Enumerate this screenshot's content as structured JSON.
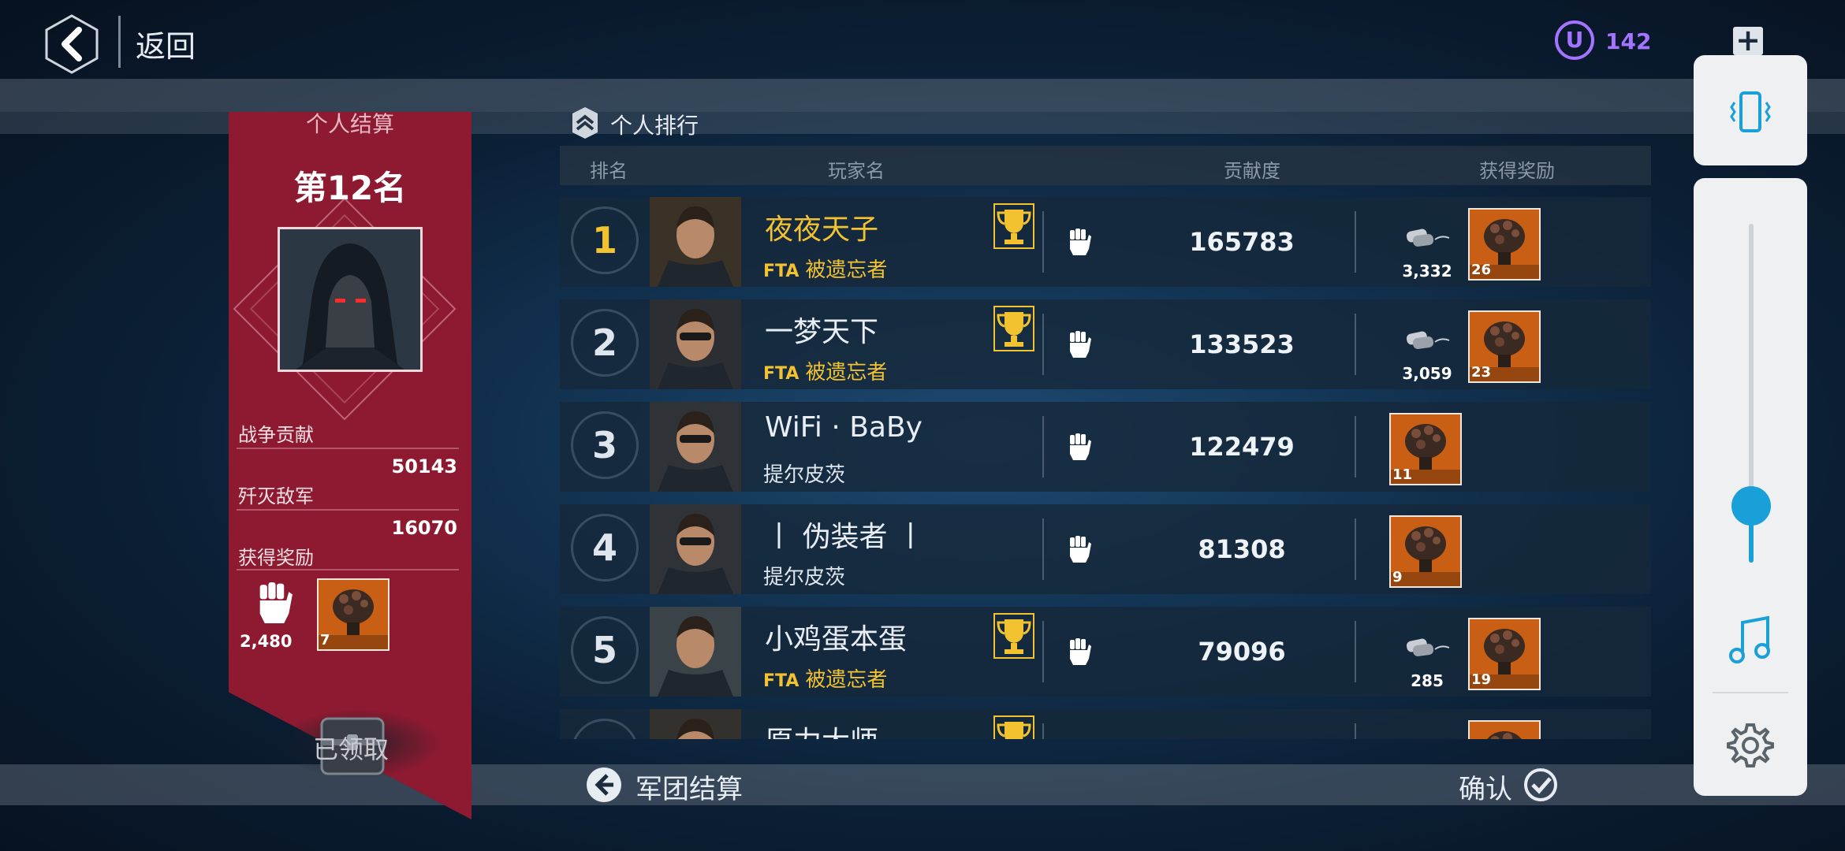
{
  "topbar": {
    "back_label": "返回",
    "currency_icon": "U",
    "currency_value": "142",
    "plus_label": "+"
  },
  "personal": {
    "title": "个人结算",
    "rank_text": "第12名",
    "stats": [
      {
        "label": "战争贡献",
        "value": "50143"
      },
      {
        "label": "歼灭敌军",
        "value": "16070"
      }
    ],
    "rewards_label": "获得奖励",
    "fist_count": "2,480",
    "reward_count": "7",
    "claimed_label": "已领取"
  },
  "ranking": {
    "title": "个人排行",
    "columns": [
      "排名",
      "玩家名",
      "贡献度",
      "获得奖励"
    ],
    "rows": [
      {
        "rank": "1",
        "name": "夜夜天子",
        "tag": "FTA",
        "guild": "被遗忘者",
        "contribution": "165783",
        "dogtag_count": "3,332",
        "reward_count": "26",
        "trophy": true
      },
      {
        "rank": "2",
        "name": "一梦天下",
        "tag": "FTA",
        "guild": "被遗忘者",
        "contribution": "133523",
        "dogtag_count": "3,059",
        "reward_count": "23",
        "trophy": true
      },
      {
        "rank": "3",
        "name": "WiFi · BaBy",
        "tag": "",
        "guild": "提尔皮茨",
        "contribution": "122479",
        "dogtag_count": "",
        "reward_count": "11",
        "trophy": false
      },
      {
        "rank": "4",
        "name": "丨 伪装者 丨",
        "tag": "",
        "guild": "提尔皮茨",
        "contribution": "81308",
        "dogtag_count": "",
        "reward_count": "9",
        "trophy": false
      },
      {
        "rank": "5",
        "name": "小鸡蛋本蛋",
        "tag": "FTA",
        "guild": "被遗忘者",
        "contribution": "79096",
        "dogtag_count": "285",
        "reward_count": "19",
        "trophy": true
      },
      {
        "rank": "",
        "name": "原力大师",
        "tag": "",
        "guild": "",
        "contribution": "",
        "dogtag_count": "",
        "reward_count": "",
        "trophy": true
      }
    ]
  },
  "bottombar": {
    "legion_label": "军团结算",
    "confirm_label": "确认"
  },
  "side_panel": {
    "slider_level": 0.12
  },
  "colors": {
    "accent_gold": "#f2c230",
    "banner_red": "#8d1a30",
    "currency_purple": "#a374ff",
    "slider_blue": "#1aa0d8"
  }
}
